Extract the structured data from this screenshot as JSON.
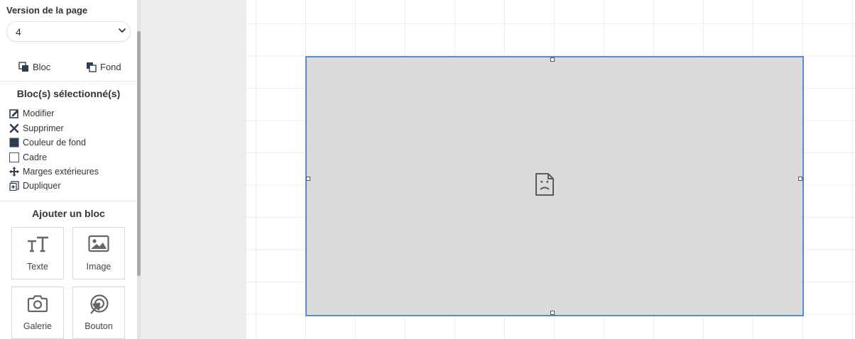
{
  "sidebar": {
    "version": {
      "label": "Version de la page",
      "value": "4"
    },
    "modes": [
      {
        "label": "Bloc",
        "icon": "bloc-icon"
      },
      {
        "label": "Fond",
        "icon": "fond-icon"
      }
    ],
    "selected_title": "Bloc(s) sélectionné(s)",
    "actions": [
      {
        "label": "Modifier",
        "icon": "edit-icon"
      },
      {
        "label": "Supprimer",
        "icon": "close-icon"
      },
      {
        "label": "Couleur de fond",
        "icon": "color-swatch-icon",
        "color": "#2f3e4f"
      },
      {
        "label": "Cadre",
        "icon": "frame-checkbox-icon"
      },
      {
        "label": "Marges extérieures",
        "icon": "move-arrows-icon"
      },
      {
        "label": "Dupliquer",
        "icon": "duplicate-icon"
      }
    ],
    "add_title": "Ajouter un bloc",
    "tiles": [
      {
        "label": "Texte",
        "icon": "text-icon"
      },
      {
        "label": "Image",
        "icon": "image-icon"
      },
      {
        "label": "Galerie",
        "icon": "camera-icon"
      },
      {
        "label": "Bouton",
        "icon": "target-pointer-icon"
      }
    ]
  },
  "canvas": {
    "block_icon": "broken-image-icon",
    "colors": {
      "selection_border": "#5b86dc",
      "block_fill": "#dcdbdc",
      "grid": "#ececec"
    }
  }
}
